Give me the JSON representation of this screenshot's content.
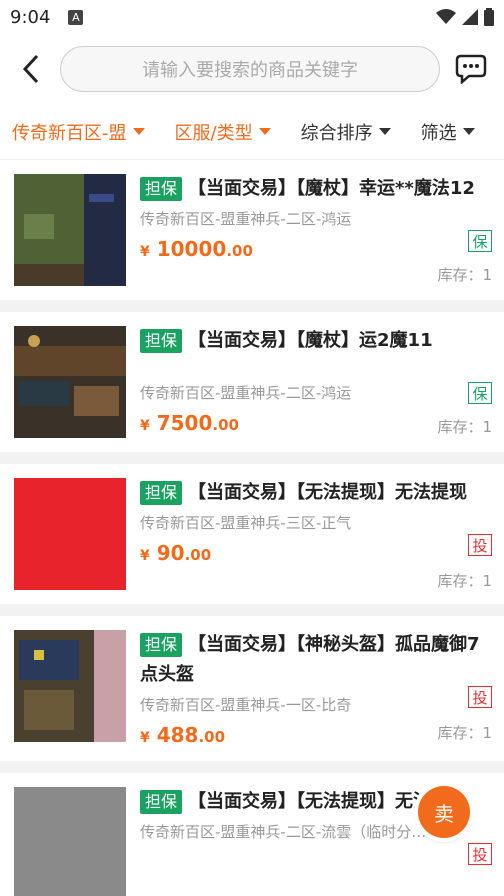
{
  "status": {
    "time": "9:04",
    "a_icon": "A"
  },
  "header": {
    "search_placeholder": "请输入要搜索的商品关键字"
  },
  "filters": [
    {
      "label": "传奇新百区-盟",
      "active": true
    },
    {
      "label": "区服/类型",
      "active": true
    },
    {
      "label": "综合排序",
      "active": false
    },
    {
      "label": "筛选",
      "active": false
    }
  ],
  "items": [
    {
      "tag": "担保",
      "title": "【当面交易】【魔杖】幸运**魔法12",
      "server": "传奇新百区-盟重神兵-二区-鸿运",
      "badge": "保",
      "price_int": "10000",
      "price_dec": ".00",
      "stock": "库存：1"
    },
    {
      "tag": "担保",
      "title": "【当面交易】【魔杖】运2魔11",
      "server": "传奇新百区-盟重神兵-二区-鸿运",
      "badge": "保",
      "price_int": "7500",
      "price_dec": ".00",
      "stock": "库存：1"
    },
    {
      "tag": "担保",
      "title": "【当面交易】【无法提现】无法提现",
      "server": "传奇新百区-盟重神兵-三区-正气",
      "badge": "投",
      "price_int": "90",
      "price_dec": ".00",
      "stock": "库存：1"
    },
    {
      "tag": "担保",
      "title": "【当面交易】【神秘头盔】孤品魔御7点头盔",
      "server": "传奇新百区-盟重神兵-一区-比奇",
      "badge": "投",
      "price_int": "488",
      "price_dec": ".00",
      "stock": "库存：1"
    },
    {
      "tag": "担保",
      "title": "【当面交易】【无法提现】无法提现",
      "server": "传奇新百区-盟重神兵-二区-流雲（临时分…",
      "badge": "投",
      "price_int": "",
      "price_dec": "",
      "stock": ""
    }
  ],
  "currency": "¥",
  "fab": {
    "label": "卖"
  },
  "colors": {
    "accent": "#f26b1d",
    "guarantee": "#1aa260",
    "complaint": "#e0303a"
  }
}
